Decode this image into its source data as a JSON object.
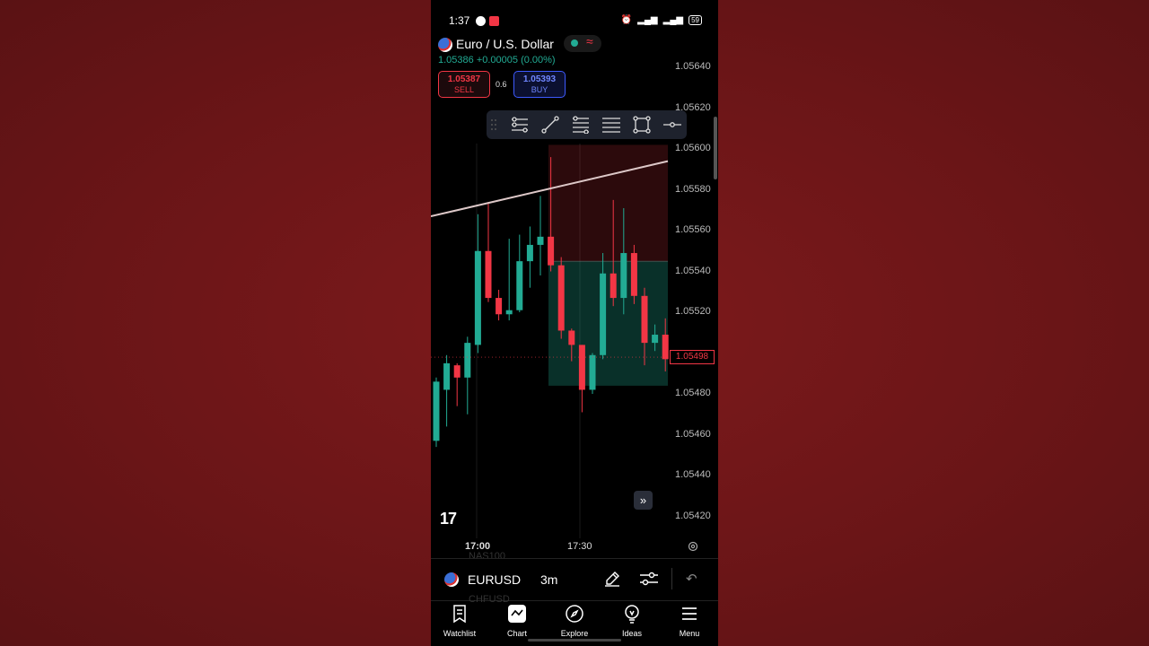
{
  "status_bar": {
    "time": "1:37",
    "battery": "59"
  },
  "header": {
    "symbol_title": "Euro / U.S. Dollar",
    "last_price": "1.05386",
    "change": "+0.00005 (0.00%)",
    "sell": {
      "price": "1.05387",
      "label": "SELL"
    },
    "buy": {
      "price": "1.05393",
      "label": "BUY"
    },
    "spread": "0.6"
  },
  "chart": {
    "price_ticks": [
      "1.05640",
      "1.05620",
      "1.05600",
      "1.05580",
      "1.05560",
      "1.05540",
      "1.05520",
      "1.05480",
      "1.05460",
      "1.05440",
      "1.05420"
    ],
    "current_price": "1.05498",
    "time_ticks": [
      "17:00",
      "17:30"
    ],
    "logo": "17"
  },
  "chart_data": {
    "type": "candlestick",
    "ylim": [
      1.05412,
      1.05652
    ],
    "price_ticks": [
      1.0564,
      1.0562,
      1.056,
      1.0558,
      1.0556,
      1.0554,
      1.0552,
      1.0548,
      1.0546,
      1.0544,
      1.0542
    ],
    "last_price": 1.05498,
    "up_color": "#22ab94",
    "down_color": "#f23645",
    "candles": [
      {
        "o": 1.05457,
        "h": 1.05488,
        "l": 1.05454,
        "c": 1.05486
      },
      {
        "o": 1.05482,
        "h": 1.05499,
        "l": 1.05464,
        "c": 1.05495
      },
      {
        "o": 1.05494,
        "h": 1.05495,
        "l": 1.05474,
        "c": 1.05488
      },
      {
        "o": 1.05488,
        "h": 1.05508,
        "l": 1.0547,
        "c": 1.05505
      },
      {
        "o": 1.05504,
        "h": 1.05568,
        "l": 1.055,
        "c": 1.0555
      },
      {
        "o": 1.0555,
        "h": 1.05574,
        "l": 1.05525,
        "c": 1.05527
      },
      {
        "o": 1.05527,
        "h": 1.05531,
        "l": 1.05516,
        "c": 1.05519
      },
      {
        "o": 1.05519,
        "h": 1.05556,
        "l": 1.05516,
        "c": 1.05521
      },
      {
        "o": 1.05521,
        "h": 1.05558,
        "l": 1.0552,
        "c": 1.05545
      },
      {
        "o": 1.05545,
        "h": 1.05562,
        "l": 1.05532,
        "c": 1.05553
      },
      {
        "o": 1.05553,
        "h": 1.05577,
        "l": 1.05538,
        "c": 1.05557
      },
      {
        "o": 1.05557,
        "h": 1.05596,
        "l": 1.0554,
        "c": 1.05543
      },
      {
        "o": 1.05543,
        "h": 1.05547,
        "l": 1.05507,
        "c": 1.05511
      },
      {
        "o": 1.05511,
        "h": 1.05512,
        "l": 1.05496,
        "c": 1.05504
      },
      {
        "o": 1.05504,
        "h": 1.05504,
        "l": 1.05471,
        "c": 1.05482
      },
      {
        "o": 1.05482,
        "h": 1.055,
        "l": 1.0548,
        "c": 1.05499
      },
      {
        "o": 1.05499,
        "h": 1.05549,
        "l": 1.05497,
        "c": 1.05539
      },
      {
        "o": 1.05539,
        "h": 1.05575,
        "l": 1.05523,
        "c": 1.05527
      },
      {
        "o": 1.05527,
        "h": 1.05571,
        "l": 1.05519,
        "c": 1.05549
      },
      {
        "o": 1.05549,
        "h": 1.05553,
        "l": 1.05524,
        "c": 1.05528
      },
      {
        "o": 1.05528,
        "h": 1.05532,
        "l": 1.05494,
        "c": 1.05505
      },
      {
        "o": 1.05505,
        "h": 1.05514,
        "l": 1.05501,
        "c": 1.05509
      },
      {
        "o": 1.05509,
        "h": 1.05517,
        "l": 1.05491,
        "c": 1.05497
      }
    ],
    "trendline": [
      1.05567,
      1.05594
    ],
    "position": {
      "entry": 1.05545,
      "stop": 1.05602,
      "target": 1.05484
    },
    "grid": true
  },
  "toolbar": {
    "symbol": "EURUSD",
    "interval": "3m",
    "ghost_top": "NAS100",
    "ghost_bottom": "CHFUSD"
  },
  "nav": [
    {
      "label": "Watchlist",
      "icon": "watchlist-icon"
    },
    {
      "label": "Chart",
      "icon": "chart-icon"
    },
    {
      "label": "Explore",
      "icon": "compass-icon"
    },
    {
      "label": "Ideas",
      "icon": "lightbulb-icon"
    },
    {
      "label": "Menu",
      "icon": "menu-icon"
    }
  ]
}
